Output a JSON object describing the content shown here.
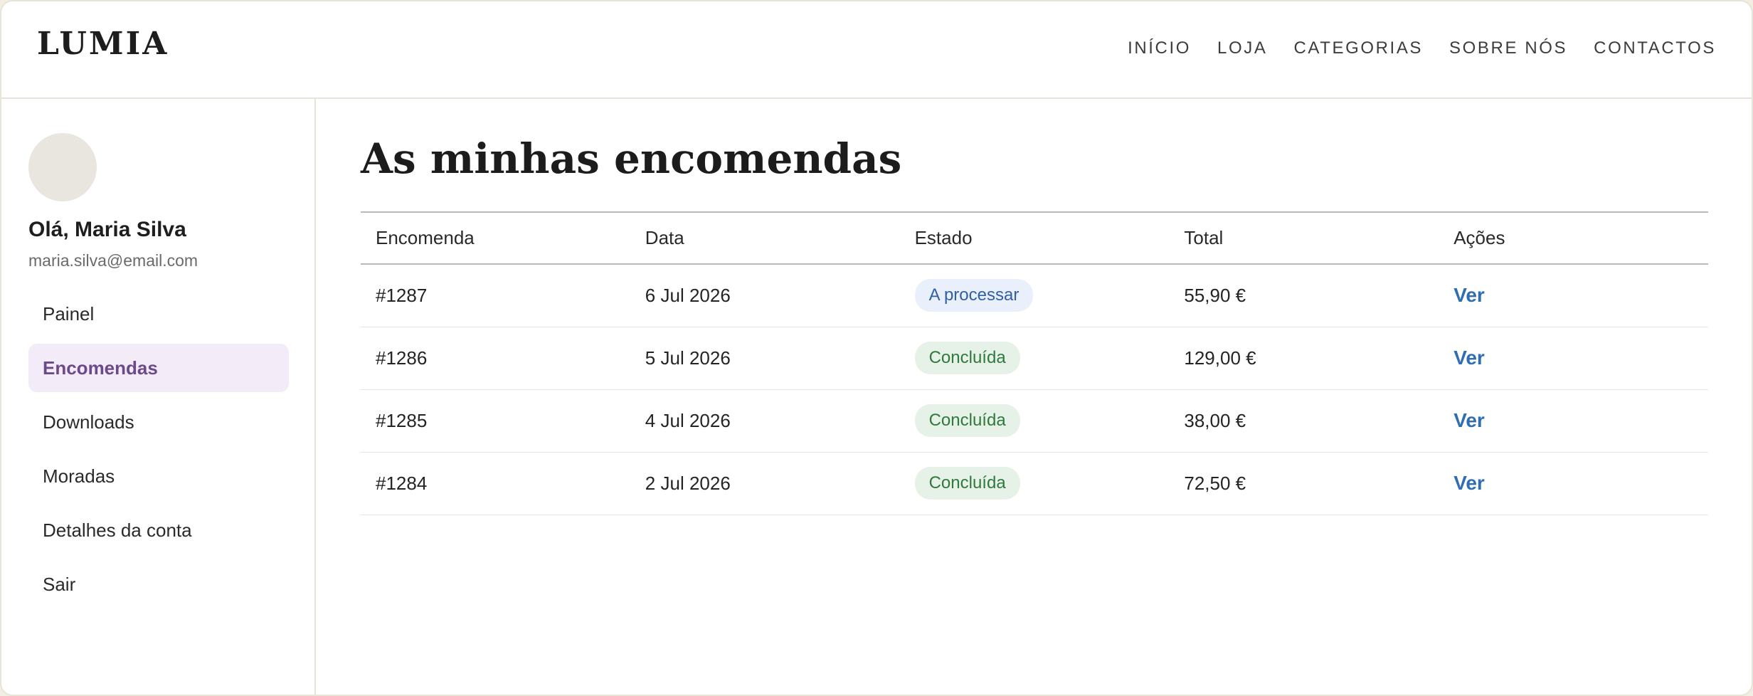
{
  "header": {
    "logo": "LUMIA",
    "nav": [
      "INÍCIO",
      "LOJA",
      "CATEGORIAS",
      "SOBRE NÓS",
      "CONTACTOS"
    ]
  },
  "sidebar": {
    "greeting": "Olá, Maria Silva",
    "email": "maria.silva@email.com",
    "items": [
      {
        "label": "Painel",
        "active": false
      },
      {
        "label": "Encomendas",
        "active": true
      },
      {
        "label": "Downloads",
        "active": false
      },
      {
        "label": "Moradas",
        "active": false
      },
      {
        "label": "Detalhes da conta",
        "active": false
      },
      {
        "label": "Sair",
        "active": false
      }
    ]
  },
  "main": {
    "title": "As minhas encomendas",
    "columns": [
      "Encomenda",
      "Data",
      "Estado",
      "Total",
      "Ações"
    ],
    "orders": [
      {
        "id": "#1287",
        "date": "6 Jul 2026",
        "status": "A processar",
        "status_type": "processing",
        "total": "55,90 €",
        "action": "Ver"
      },
      {
        "id": "#1286",
        "date": "5 Jul 2026",
        "status": "Concluída",
        "status_type": "done",
        "total": "129,00 €",
        "action": "Ver"
      },
      {
        "id": "#1285",
        "date": "4 Jul 2026",
        "status": "Concluída",
        "status_type": "done",
        "total": "38,00 €",
        "action": "Ver"
      },
      {
        "id": "#1284",
        "date": "2 Jul 2026",
        "status": "Concluída",
        "status_type": "done",
        "total": "72,50 €",
        "action": "Ver"
      }
    ]
  },
  "colors": {
    "accent": "#6c4a8a",
    "active_bg": "#f3ecf8",
    "link": "#2f6db5",
    "processing_bg": "#e9f0fb",
    "processing_fg": "#2f5fa9",
    "done_bg": "#e6f2e7",
    "done_fg": "#2f7a3a"
  }
}
